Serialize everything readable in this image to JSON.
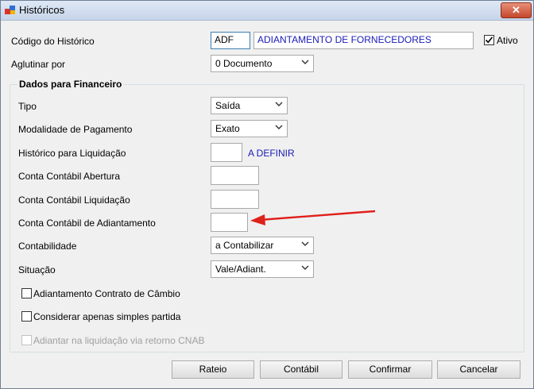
{
  "window": {
    "title": "Históricos",
    "close_label": "✕"
  },
  "form": {
    "codigo_label": "Código do Histórico",
    "codigo_value": "ADF",
    "descricao_value": "ADIANTAMENTO DE FORNECEDORES",
    "ativo_label": "Ativo",
    "ativo_checked": true,
    "aglutinar_label": "Aglutinar por",
    "aglutinar_value": "0 Documento"
  },
  "financeiro": {
    "group_title": "Dados para Financeiro",
    "tipo_label": "Tipo",
    "tipo_value": "Saída",
    "modalidade_label": "Modalidade de Pagamento",
    "modalidade_value": "Exato",
    "hist_liq_label": "Histórico para Liquidação",
    "hist_liq_value": "",
    "hist_liq_desc": "A DEFINIR",
    "conta_abertura_label": "Conta Contábil Abertura",
    "conta_liquidacao_label": "Conta Contábil Liquidação",
    "conta_adiantamento_label": "Conta Contábil de Adiantamento",
    "contabilidade_label": "Contabilidade",
    "contabilidade_value": "a Contabilizar",
    "situacao_label": "Situação",
    "situacao_value": "Vale/Adiant.",
    "chk_cambio_label": "Adiantamento Contrato de Câmbio",
    "chk_simples_label": "Considerar apenas simples partida",
    "chk_cnab_label": "Adiantar na liquidação via retorno CNAB"
  },
  "buttons": {
    "rateio": "Rateio",
    "contabil": "Contábil",
    "confirmar": "Confirmar",
    "cancelar": "Cancelar"
  },
  "colors": {
    "annotation_arrow": "#e0201b",
    "link_text": "#1a1ab8"
  }
}
